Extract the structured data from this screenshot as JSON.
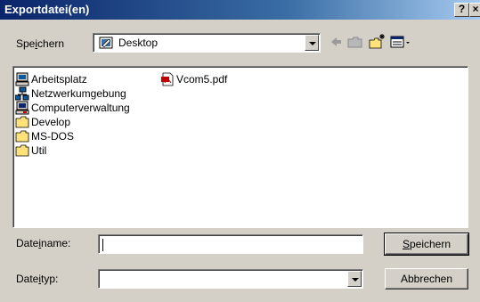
{
  "window": {
    "title": "Exportdatei(en)",
    "help_label": "?",
    "close_label": "×"
  },
  "toolbar": {
    "save_in_label_pre": "Spe",
    "save_in_label_u": "i",
    "save_in_label_post": "chern",
    "location": "Desktop"
  },
  "files": [
    {
      "name": "Arbeitsplatz",
      "icon": "computer-icon"
    },
    {
      "name": "Netzwerkumgebung",
      "icon": "network-icon"
    },
    {
      "name": "Computerverwaltung",
      "icon": "computer-management-icon"
    },
    {
      "name": "Develop",
      "icon": "folder-icon"
    },
    {
      "name": "MS-DOS",
      "icon": "folder-icon"
    },
    {
      "name": "Util",
      "icon": "folder-icon"
    },
    {
      "name": "Vcom5.pdf",
      "icon": "pdf-icon"
    }
  ],
  "form": {
    "filename_label_pre": "Date",
    "filename_label_u": "i",
    "filename_label_post": "name:",
    "filename_value": "",
    "filetype_label_pre": "Date",
    "filetype_label_u": "i",
    "filetype_label_post": "typ:",
    "filetype_value": ""
  },
  "buttons": {
    "save_u": "S",
    "save_rest": "peichern",
    "cancel": "Abbrechen"
  }
}
